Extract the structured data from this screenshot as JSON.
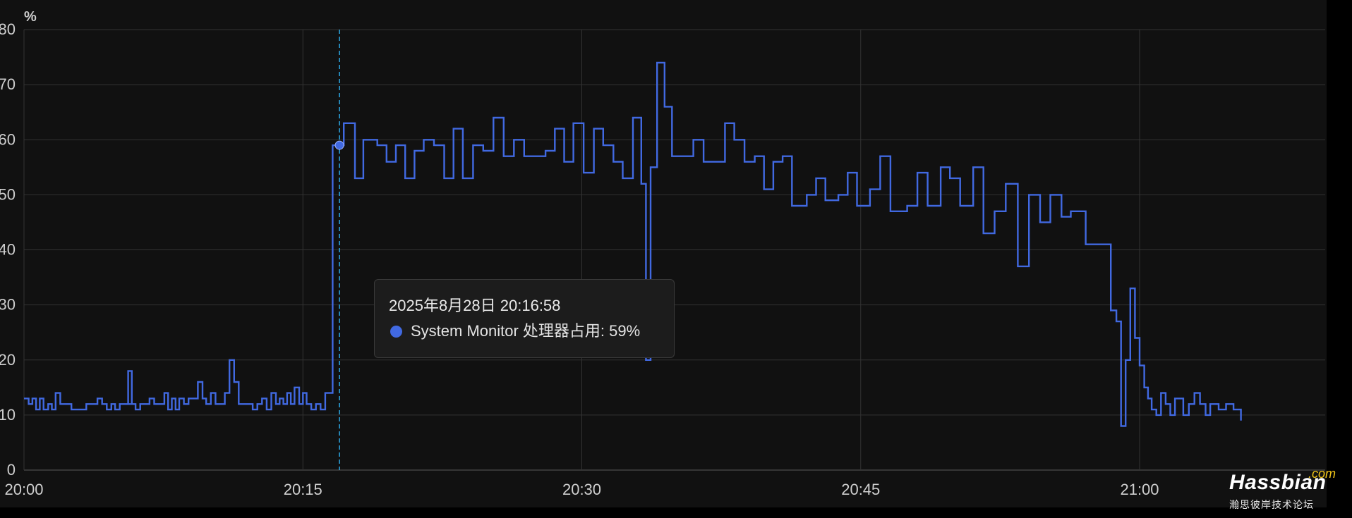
{
  "chart_data": {
    "type": "line",
    "y_unit": "%",
    "y_ticks": [
      0,
      10,
      20,
      30,
      40,
      50,
      60,
      70,
      80
    ],
    "ylim": [
      0,
      80
    ],
    "x_ticks": [
      {
        "t": 0,
        "label": "20:00"
      },
      {
        "t": 15,
        "label": "20:15"
      },
      {
        "t": 30,
        "label": "20:30"
      },
      {
        "t": 45,
        "label": "20:45"
      },
      {
        "t": 60,
        "label": "21:00"
      }
    ],
    "xlim_minutes_after_20_00": [
      0,
      69.6
    ],
    "grid": true,
    "series": [
      {
        "name": "System Monitor 处理器占用",
        "color": "#4169e1",
        "step": true,
        "points": [
          [
            0.0,
            13
          ],
          [
            0.25,
            12
          ],
          [
            0.45,
            13
          ],
          [
            0.65,
            11
          ],
          [
            0.85,
            13
          ],
          [
            1.05,
            11
          ],
          [
            1.3,
            12
          ],
          [
            1.5,
            11
          ],
          [
            1.7,
            14
          ],
          [
            1.95,
            12
          ],
          [
            2.3,
            12
          ],
          [
            2.55,
            11
          ],
          [
            3.0,
            11
          ],
          [
            3.35,
            12
          ],
          [
            3.7,
            12
          ],
          [
            3.95,
            13
          ],
          [
            4.2,
            12
          ],
          [
            4.45,
            11
          ],
          [
            4.7,
            12
          ],
          [
            4.9,
            11
          ],
          [
            5.15,
            12
          ],
          [
            5.5,
            12
          ],
          [
            5.75,
            12
          ],
          [
            5.6,
            18
          ],
          [
            5.8,
            12
          ],
          [
            6.0,
            11
          ],
          [
            6.25,
            12
          ],
          [
            6.5,
            12
          ],
          [
            6.75,
            13
          ],
          [
            7.0,
            12
          ],
          [
            7.25,
            12
          ],
          [
            7.55,
            14
          ],
          [
            7.75,
            11
          ],
          [
            7.95,
            13
          ],
          [
            8.15,
            11
          ],
          [
            8.35,
            13
          ],
          [
            8.6,
            12
          ],
          [
            8.85,
            13
          ],
          [
            9.1,
            13
          ],
          [
            9.35,
            16
          ],
          [
            9.6,
            13
          ],
          [
            9.8,
            12
          ],
          [
            10.05,
            14
          ],
          [
            10.3,
            12
          ],
          [
            10.55,
            12
          ],
          [
            10.8,
            14
          ],
          [
            11.05,
            20
          ],
          [
            11.3,
            16
          ],
          [
            11.55,
            12
          ],
          [
            11.8,
            12
          ],
          [
            12.05,
            12
          ],
          [
            12.3,
            11
          ],
          [
            12.55,
            12
          ],
          [
            12.8,
            13
          ],
          [
            13.05,
            11
          ],
          [
            13.3,
            14
          ],
          [
            13.55,
            12
          ],
          [
            13.75,
            13
          ],
          [
            13.95,
            12
          ],
          [
            14.15,
            14
          ],
          [
            14.35,
            12
          ],
          [
            14.55,
            15
          ],
          [
            14.8,
            12
          ],
          [
            15.0,
            14
          ],
          [
            15.2,
            12
          ],
          [
            15.45,
            11
          ],
          [
            15.7,
            12
          ],
          [
            15.95,
            11
          ],
          [
            16.2,
            14
          ],
          [
            16.55,
            14
          ],
          [
            16.6,
            59
          ],
          [
            17.0,
            59
          ],
          [
            17.2,
            63
          ],
          [
            17.65,
            63
          ],
          [
            17.8,
            53
          ],
          [
            18.2,
            53
          ],
          [
            18.25,
            60
          ],
          [
            18.75,
            60
          ],
          [
            19.0,
            59
          ],
          [
            19.4,
            59
          ],
          [
            19.5,
            56
          ],
          [
            19.85,
            56
          ],
          [
            20.0,
            59
          ],
          [
            20.4,
            59
          ],
          [
            20.5,
            53
          ],
          [
            20.85,
            53
          ],
          [
            21.0,
            58
          ],
          [
            21.35,
            58
          ],
          [
            21.5,
            60
          ],
          [
            21.85,
            60
          ],
          [
            22.05,
            59
          ],
          [
            22.45,
            59
          ],
          [
            22.6,
            53
          ],
          [
            22.95,
            53
          ],
          [
            23.1,
            62
          ],
          [
            23.5,
            62
          ],
          [
            23.6,
            53
          ],
          [
            24.0,
            53
          ],
          [
            24.15,
            59
          ],
          [
            24.55,
            59
          ],
          [
            24.7,
            58
          ],
          [
            25.1,
            58
          ],
          [
            25.25,
            64
          ],
          [
            25.7,
            64
          ],
          [
            25.8,
            57
          ],
          [
            26.2,
            57
          ],
          [
            26.35,
            60
          ],
          [
            26.75,
            60
          ],
          [
            26.9,
            57
          ],
          [
            27.3,
            57
          ],
          [
            27.5,
            57
          ],
          [
            27.95,
            57
          ],
          [
            28.05,
            58
          ],
          [
            28.45,
            58
          ],
          [
            28.55,
            62
          ],
          [
            28.95,
            62
          ],
          [
            29.05,
            56
          ],
          [
            29.45,
            56
          ],
          [
            29.55,
            63
          ],
          [
            29.95,
            63
          ],
          [
            30.1,
            54
          ],
          [
            30.5,
            54
          ],
          [
            30.65,
            62
          ],
          [
            31.05,
            62
          ],
          [
            31.15,
            59
          ],
          [
            31.55,
            59
          ],
          [
            31.7,
            56
          ],
          [
            32.1,
            56
          ],
          [
            32.2,
            53
          ],
          [
            32.6,
            53
          ],
          [
            32.75,
            64
          ],
          [
            33.15,
            64
          ],
          [
            33.2,
            52
          ],
          [
            33.4,
            52
          ],
          [
            33.45,
            20
          ],
          [
            33.65,
            20
          ],
          [
            33.7,
            55
          ],
          [
            33.95,
            55
          ],
          [
            34.05,
            74
          ],
          [
            34.4,
            74
          ],
          [
            34.45,
            66
          ],
          [
            34.8,
            66
          ],
          [
            34.85,
            57
          ],
          [
            35.9,
            57
          ],
          [
            36.0,
            60
          ],
          [
            36.45,
            60
          ],
          [
            36.55,
            56
          ],
          [
            37.6,
            56
          ],
          [
            37.7,
            63
          ],
          [
            38.1,
            63
          ],
          [
            38.2,
            60
          ],
          [
            38.65,
            60
          ],
          [
            38.75,
            56
          ],
          [
            39.2,
            56
          ],
          [
            39.3,
            57
          ],
          [
            39.7,
            57
          ],
          [
            39.8,
            51
          ],
          [
            40.2,
            51
          ],
          [
            40.3,
            56
          ],
          [
            40.7,
            56
          ],
          [
            40.8,
            57
          ],
          [
            41.2,
            57
          ],
          [
            41.3,
            48
          ],
          [
            42.0,
            48
          ],
          [
            42.1,
            50
          ],
          [
            42.5,
            50
          ],
          [
            42.6,
            53
          ],
          [
            43.0,
            53
          ],
          [
            43.1,
            49
          ],
          [
            43.7,
            49
          ],
          [
            43.8,
            50
          ],
          [
            44.2,
            50
          ],
          [
            44.3,
            54
          ],
          [
            44.7,
            54
          ],
          [
            44.8,
            48
          ],
          [
            45.4,
            48
          ],
          [
            45.5,
            51
          ],
          [
            45.95,
            51
          ],
          [
            46.05,
            57
          ],
          [
            46.5,
            57
          ],
          [
            46.6,
            47
          ],
          [
            47.4,
            47
          ],
          [
            47.5,
            48
          ],
          [
            47.95,
            48
          ],
          [
            48.05,
            54
          ],
          [
            48.5,
            54
          ],
          [
            48.6,
            48
          ],
          [
            49.2,
            48
          ],
          [
            49.3,
            55
          ],
          [
            49.7,
            55
          ],
          [
            49.8,
            53
          ],
          [
            50.25,
            53
          ],
          [
            50.35,
            48
          ],
          [
            50.95,
            48
          ],
          [
            51.05,
            55
          ],
          [
            51.5,
            55
          ],
          [
            51.6,
            43
          ],
          [
            52.1,
            43
          ],
          [
            52.2,
            47
          ],
          [
            52.7,
            47
          ],
          [
            52.8,
            52
          ],
          [
            53.35,
            52
          ],
          [
            53.45,
            37
          ],
          [
            53.95,
            37
          ],
          [
            54.05,
            50
          ],
          [
            54.55,
            50
          ],
          [
            54.65,
            45
          ],
          [
            55.1,
            45
          ],
          [
            55.2,
            50
          ],
          [
            55.7,
            50
          ],
          [
            55.8,
            46
          ],
          [
            56.2,
            46
          ],
          [
            56.3,
            47
          ],
          [
            57.0,
            47
          ],
          [
            57.1,
            41
          ],
          [
            58.4,
            41
          ],
          [
            58.45,
            29
          ],
          [
            58.5,
            29
          ],
          [
            58.75,
            27
          ],
          [
            58.95,
            27
          ],
          [
            59.0,
            8
          ],
          [
            59.2,
            8
          ],
          [
            59.25,
            20
          ],
          [
            59.45,
            20
          ],
          [
            59.5,
            33
          ],
          [
            59.7,
            33
          ],
          [
            59.75,
            24
          ],
          [
            59.95,
            24
          ],
          [
            60.0,
            19
          ],
          [
            60.2,
            19
          ],
          [
            60.25,
            15
          ],
          [
            60.4,
            15
          ],
          [
            60.45,
            13
          ],
          [
            60.6,
            13
          ],
          [
            60.65,
            11
          ],
          [
            60.85,
            11
          ],
          [
            60.9,
            10
          ],
          [
            61.1,
            10
          ],
          [
            61.15,
            14
          ],
          [
            61.35,
            14
          ],
          [
            61.4,
            12
          ],
          [
            61.6,
            12
          ],
          [
            61.65,
            10
          ],
          [
            61.85,
            10
          ],
          [
            61.9,
            13
          ],
          [
            62.3,
            13
          ],
          [
            62.35,
            10
          ],
          [
            62.6,
            10
          ],
          [
            62.65,
            12
          ],
          [
            62.9,
            12
          ],
          [
            62.95,
            14
          ],
          [
            63.2,
            14
          ],
          [
            63.25,
            12
          ],
          [
            63.5,
            12
          ],
          [
            63.55,
            10
          ],
          [
            63.75,
            10
          ],
          [
            63.8,
            12
          ],
          [
            64.2,
            12
          ],
          [
            64.25,
            11
          ],
          [
            64.6,
            11
          ],
          [
            64.65,
            12
          ],
          [
            65.0,
            12
          ],
          [
            65.05,
            11
          ],
          [
            65.4,
            11
          ],
          [
            65.45,
            9
          ]
        ]
      }
    ],
    "hover": {
      "t": 16.967,
      "value": 59
    },
    "tooltip": {
      "time": "2025年8月28日 20:16:58",
      "series_label": "System Monitor 处理器占用: 59%"
    }
  },
  "watermark": {
    "name": "Hassbian",
    "com": ".com",
    "subtitle": "瀚思彼岸技术论坛"
  }
}
